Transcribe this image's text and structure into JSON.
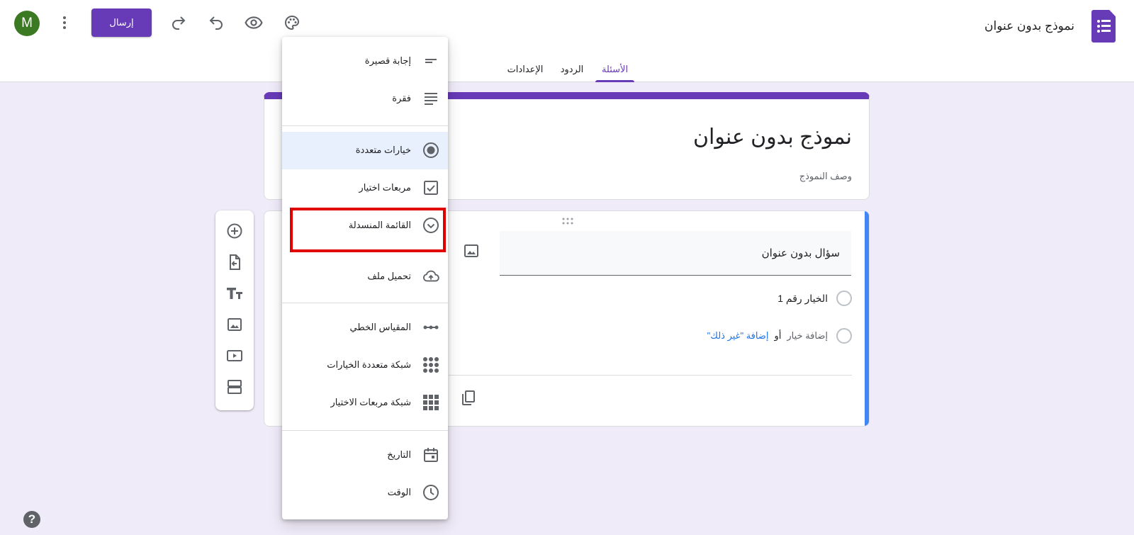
{
  "header": {
    "title": "نموذج بدون عنوان",
    "send_label": "إرسال",
    "avatar_letter": "M",
    "tabs": [
      {
        "label": "الأسئلة",
        "active": true
      },
      {
        "label": "الردود",
        "active": false
      },
      {
        "label": "الإعدادات",
        "active": false
      }
    ],
    "icons": [
      "palette-icon",
      "preview-eye-icon",
      "undo-icon",
      "redo-icon",
      "more-vert-icon"
    ]
  },
  "form": {
    "title": "نموذج بدون عنوان",
    "description_placeholder": "وصف النموذج"
  },
  "question": {
    "title": "سؤال بدون عنوان",
    "options": [
      "الخيار رقم 1"
    ],
    "add_option": "إضافة خيار",
    "or": "أو",
    "add_other": "إضافة \"غير ذلك\""
  },
  "menu": {
    "items": [
      {
        "label": "إجابة قصيرة",
        "icon": "short-answer-icon"
      },
      {
        "label": "فقرة",
        "icon": "paragraph-icon"
      },
      {
        "label": "خيارات متعددة",
        "icon": "radio-icon",
        "selected": true
      },
      {
        "label": "مربعات اختيار",
        "icon": "checkbox-icon"
      },
      {
        "label": "القائمة المنسدلة",
        "icon": "dropdown-icon",
        "highlighted": true
      },
      {
        "label": "تحميل ملف",
        "icon": "upload-cloud-icon"
      },
      {
        "label": "المقياس الخطي",
        "icon": "linear-scale-icon"
      },
      {
        "label": "شبكة متعددة الخيارات",
        "icon": "dot-grid-icon"
      },
      {
        "label": "شبكة مربعات الاختيار",
        "icon": "square-grid-icon"
      },
      {
        "label": "التاريخ",
        "icon": "calendar-icon"
      },
      {
        "label": "الوقت",
        "icon": "clock-icon"
      }
    ]
  },
  "colors": {
    "brand": "#673ab7",
    "background": "#f0ebf8",
    "question_accent": "#4285f4",
    "highlight": "#e00000"
  }
}
